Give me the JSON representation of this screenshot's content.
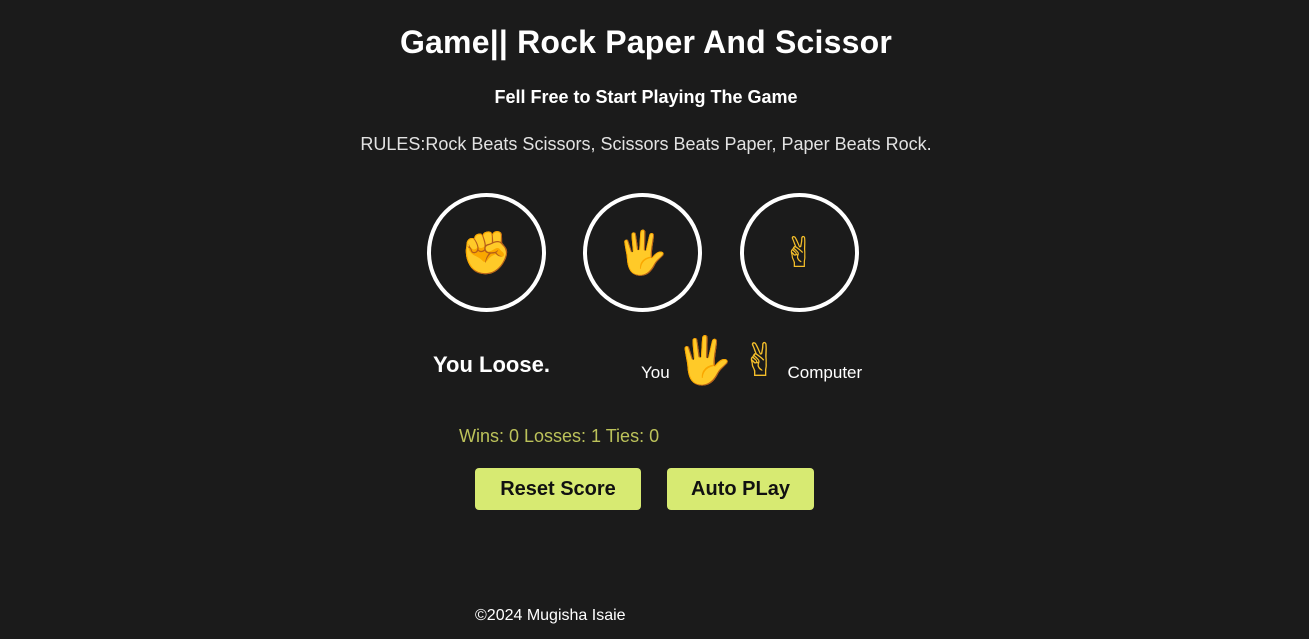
{
  "header": {
    "title": "Game|| Rock Paper And Scissor",
    "subtitle": "Fell Free to Start Playing The Game",
    "rules": "RULES:Rock Beats Scissors, Scissors Beats Paper, Paper Beats Rock."
  },
  "moves": {
    "rock": {
      "icon": "raised-fist-icon",
      "glyph": "✊"
    },
    "paper": {
      "icon": "raised-hand-icon",
      "glyph": "🖐"
    },
    "scissors": {
      "icon": "victory-hand-icon",
      "glyph": "✌"
    }
  },
  "result": {
    "text": "You Loose.",
    "you_label": "You",
    "you_move_glyph": "🖐",
    "computer_move_glyph": "✌",
    "computer_label": "Computer"
  },
  "score": {
    "text": "Wins: 0 Losses: 1 Ties: 0",
    "wins": 0,
    "losses": 1,
    "ties": 0
  },
  "buttons": {
    "reset_label": "Reset Score",
    "auto_label": "Auto PLay"
  },
  "footer": {
    "copyright": "©2024 Mugisha Isaie"
  },
  "colors": {
    "background": "#1b1b1b",
    "button_bg": "#d7ea72",
    "score_text": "#bcc25a",
    "emoji": "#f5bf2a"
  }
}
